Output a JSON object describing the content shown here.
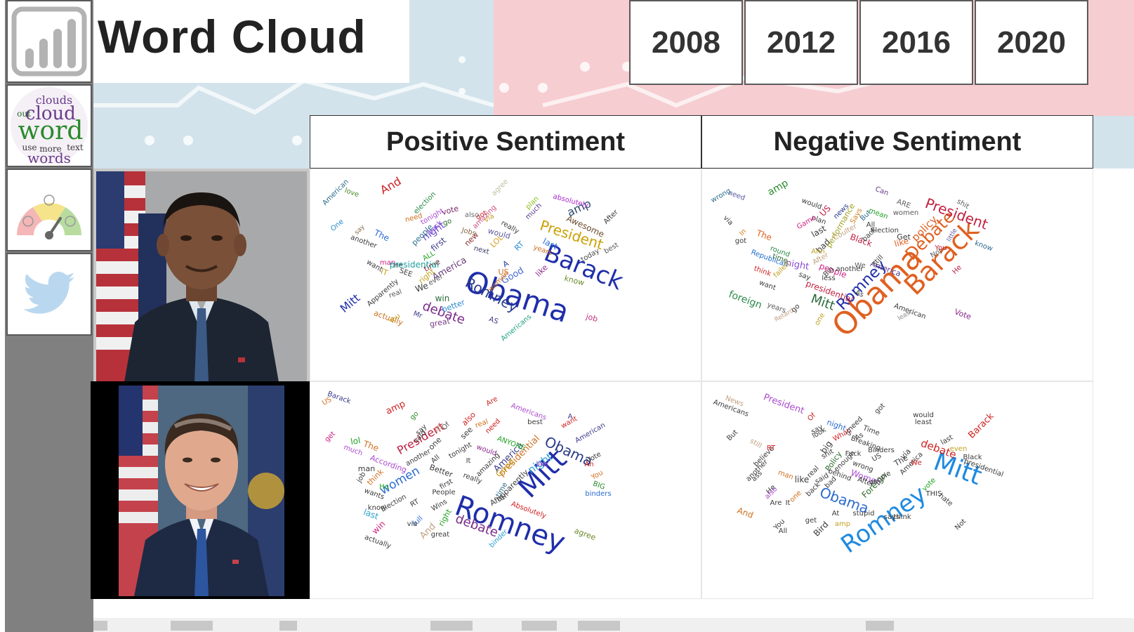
{
  "header": {
    "title": "Word Cloud"
  },
  "nav": {
    "report_icon": "report-bar-chart-icon",
    "cloud_icon": "word-cloud-icon",
    "gauge_icon": "sentiment-gauge-icon",
    "twitter_icon": "twitter-bird-icon",
    "cloud_thumb_words": [
      "clouds",
      "cloud",
      "word",
      "out",
      "use",
      "more",
      "text",
      "words"
    ]
  },
  "years": [
    "2008",
    "2012",
    "2016",
    "2020"
  ],
  "columns": {
    "positive": "Positive Sentiment",
    "negative": "Negative Sentiment"
  },
  "colors": {
    "nav_bg": "#808080",
    "blue_band": "#d3e3ec",
    "pink_band": "#f6cdd1"
  },
  "clouds": {
    "obama_positive": [
      {
        "w": "Obama",
        "c": "#1f2eaa"
      },
      {
        "w": "Barack",
        "c": "#1f2eaa"
      },
      {
        "w": "Romney",
        "c": "#2a3a8a"
      },
      {
        "w": "President",
        "c": "#c9a000"
      },
      {
        "w": "debate",
        "c": "#7a2a8a"
      },
      {
        "w": "Mitt",
        "c": "#1f2eaa"
      },
      {
        "w": "And",
        "c": "#d02020"
      },
      {
        "w": "amp",
        "c": "#2a4a6a"
      },
      {
        "w": "Good",
        "c": "#4a6ad0"
      },
      {
        "w": "America",
        "c": "#6a3a7a"
      },
      {
        "w": "night",
        "c": "#6a4ad0"
      },
      {
        "w": "first",
        "c": "#3a3a8a"
      },
      {
        "w": "win",
        "c": "#2a6a3a"
      },
      {
        "w": "better",
        "c": "#2a8ad0"
      },
      {
        "w": "great",
        "c": "#7a3a8a"
      },
      {
        "w": "job",
        "c": "#c03080"
      },
      {
        "w": "know",
        "c": "#6a8a2a"
      },
      {
        "w": "like",
        "c": "#8a2a8a"
      },
      {
        "w": "last",
        "c": "#1f6ad0"
      },
      {
        "w": "Awesome",
        "c": "#6a4a2a"
      },
      {
        "w": "vote",
        "c": "#7a2a6a"
      },
      {
        "w": "American",
        "c": "#2a6a8a"
      },
      {
        "w": "love",
        "c": "#4a8a2a"
      },
      {
        "w": "One",
        "c": "#2a8ad0"
      },
      {
        "w": "The",
        "c": "#2a6ad0"
      },
      {
        "w": "another",
        "c": "#3a3a3a"
      },
      {
        "w": "say",
        "c": "#8a6a4a"
      },
      {
        "w": "need",
        "c": "#d07020"
      },
      {
        "w": "people",
        "c": "#2a6a8a"
      },
      {
        "w": "back",
        "c": "#8a4ad0"
      },
      {
        "w": "election",
        "c": "#2a8a4a"
      },
      {
        "w": "tonight",
        "c": "#aa4ad0"
      },
      {
        "w": "agree",
        "c": "#c0c0a0"
      },
      {
        "w": "got",
        "c": "#d02020"
      },
      {
        "w": "amazing",
        "c": "#d05080"
      },
      {
        "w": "via",
        "c": "#c0a020"
      },
      {
        "w": "Jobs",
        "c": "#8a6a4a"
      },
      {
        "w": "new",
        "c": "#8a2a2a"
      },
      {
        "w": "next",
        "c": "#3a3a6a"
      },
      {
        "w": "would",
        "c": "#5a5aa0"
      },
      {
        "w": "LOL",
        "c": "#d0a020"
      },
      {
        "w": "really",
        "c": "#3a3a3a"
      },
      {
        "w": "RT",
        "c": "#2a8ad0"
      },
      {
        "w": "years",
        "c": "#d07020"
      },
      {
        "w": "today",
        "c": "#4a4a4a"
      },
      {
        "w": "best",
        "c": "#5a5a5a"
      },
      {
        "w": "After",
        "c": "#3a3a3a"
      },
      {
        "w": "absolutely",
        "c": "#aa2ad0"
      },
      {
        "w": "much",
        "c": "#5a3a8a"
      },
      {
        "w": "plan",
        "c": "#8ac020"
      },
      {
        "w": "go",
        "c": "#2a6a2a"
      },
      {
        "w": "IT",
        "c": "#c0a020"
      },
      {
        "w": "Apparently",
        "c": "#3a3a3a"
      },
      {
        "w": "real",
        "c": "#5a5a5a"
      },
      {
        "w": "We",
        "c": "#3a3a3a"
      },
      {
        "w": "right",
        "c": "#c0a020"
      },
      {
        "w": "ever",
        "c": "#5a5a5a"
      },
      {
        "w": "time",
        "c": "#8a2a2a"
      },
      {
        "w": "ALL",
        "c": "#20a020"
      },
      {
        "w": "want",
        "c": "#3a3a3a"
      },
      {
        "w": "man",
        "c": "#d02080"
      },
      {
        "w": "He",
        "c": "#3a3a3a"
      },
      {
        "w": "SEE",
        "c": "#3a3a3a"
      },
      {
        "w": "presidential",
        "c": "#20a0a0"
      },
      {
        "w": "A",
        "c": "#2a3a8a"
      },
      {
        "w": "US",
        "c": "#d07020"
      },
      {
        "w": "women",
        "c": "#d07020"
      },
      {
        "w": "AS",
        "c": "#3a3a8a"
      },
      {
        "w": "Americans",
        "c": "#20a080"
      },
      {
        "w": "actually",
        "c": "#d07020"
      },
      {
        "w": "You",
        "c": "#c0a020"
      },
      {
        "w": "Mr",
        "c": "#3a3a8a"
      },
      {
        "w": "also",
        "c": "#6a6a6a"
      },
      {
        "w": "Are",
        "c": "#3a3a3a"
      }
    ],
    "obama_negative": [
      {
        "w": "Obama",
        "c": "#e06020"
      },
      {
        "w": "Barack",
        "c": "#e06020"
      },
      {
        "w": "Debate",
        "c": "#e06020"
      },
      {
        "w": "Romney",
        "c": "#1f2eaa"
      },
      {
        "w": "President",
        "c": "#c02040"
      },
      {
        "w": "Mitt",
        "c": "#2a6a3a"
      },
      {
        "w": "policy",
        "c": "#e06020"
      },
      {
        "w": "foreign",
        "c": "#2a8a4a"
      },
      {
        "w": "amp",
        "c": "#2a8a2a"
      },
      {
        "w": "people",
        "c": "#d02080"
      },
      {
        "w": "night",
        "c": "#8a4ad0"
      },
      {
        "w": "presidential",
        "c": "#c02040"
      },
      {
        "w": "America",
        "c": "#5a3a8a"
      },
      {
        "w": "like",
        "c": "#e06020"
      },
      {
        "w": "bad",
        "c": "#3a3a3a"
      },
      {
        "w": "last",
        "c": "#3a3a3a"
      },
      {
        "w": "Black",
        "c": "#c02040"
      },
      {
        "w": "The",
        "c": "#e06020"
      },
      {
        "w": "wrong",
        "c": "#2a6a8a"
      },
      {
        "w": "need",
        "c": "#5a5aa0"
      },
      {
        "w": "would",
        "c": "#3a3a3a"
      },
      {
        "w": "US",
        "c": "#c02040"
      },
      {
        "w": "plan",
        "c": "#3a3a3a"
      },
      {
        "w": "news",
        "c": "#2a3a8a"
      },
      {
        "w": "Says",
        "c": "#d08020"
      },
      {
        "w": "But",
        "c": "#2a6a8a"
      },
      {
        "w": "mean",
        "c": "#20a020"
      },
      {
        "w": "Can",
        "c": "#6a3a8a"
      },
      {
        "w": "ARE",
        "c": "#5a5a5a"
      },
      {
        "w": "women",
        "c": "#5a5a5a"
      },
      {
        "w": "shit",
        "c": "#5a5a5a"
      },
      {
        "w": "know",
        "c": "#2a6a8a"
      },
      {
        "w": "little",
        "c": "#5a5aa0"
      },
      {
        "w": "He",
        "c": "#c02040"
      },
      {
        "w": "Vote",
        "c": "#8a2a8a"
      },
      {
        "w": "American",
        "c": "#3a3a3a"
      },
      {
        "w": "least",
        "c": "#8a8a8a"
      },
      {
        "w": "Retard",
        "c": "#c0a080"
      },
      {
        "w": "go",
        "c": "#3a3a3a"
      },
      {
        "w": "years",
        "c": "#5a5a5a"
      },
      {
        "w": "one",
        "c": "#c0a020"
      },
      {
        "w": "Republican",
        "c": "#1f6ad0"
      },
      {
        "w": "round",
        "c": "#2a8a4a"
      },
      {
        "w": "time",
        "c": "#2a6a2a"
      },
      {
        "w": "failed",
        "c": "#c0a020"
      },
      {
        "w": "think",
        "c": "#d02020"
      },
      {
        "w": "want",
        "c": "#3a3a3a"
      },
      {
        "w": "say",
        "c": "#3a3a3a"
      },
      {
        "w": "less",
        "c": "#3a3a3a"
      },
      {
        "w": "Big",
        "c": "#3a3a3a"
      },
      {
        "w": "another",
        "c": "#3a3a3a"
      },
      {
        "w": "Game",
        "c": "#d02080"
      },
      {
        "w": "performance",
        "c": "#a0a020"
      },
      {
        "w": "Coulter",
        "c": "#c0a080"
      },
      {
        "w": "All",
        "c": "#3a3a3a"
      },
      {
        "w": "back",
        "c": "#3a3a3a"
      },
      {
        "w": "Election",
        "c": "#3a3a3a"
      },
      {
        "w": "Get",
        "c": "#3a3a3a"
      },
      {
        "w": "You",
        "c": "#c02040"
      },
      {
        "w": "Not",
        "c": "#5a5a5a"
      },
      {
        "w": "We",
        "c": "#5a5a5a"
      },
      {
        "w": "still",
        "c": "#3a3a3a"
      },
      {
        "w": "After",
        "c": "#c0a080"
      },
      {
        "w": "Ann",
        "c": "#c0a020"
      },
      {
        "w": "As",
        "c": "#3a3a3a"
      },
      {
        "w": "via",
        "c": "#3a3a3a"
      },
      {
        "w": "In",
        "c": "#d08020"
      },
      {
        "w": "got",
        "c": "#3a3a3a"
      },
      {
        "w": "RT",
        "c": "#3a3a3a"
      }
    ],
    "romney_positive": [
      {
        "w": "Romney",
        "c": "#1f2eaa"
      },
      {
        "w": "Mitt",
        "c": "#1f2eaa"
      },
      {
        "w": "debate",
        "c": "#7a2a8a"
      },
      {
        "w": "Obama",
        "c": "#2a3a8a"
      },
      {
        "w": "President",
        "c": "#c02040"
      },
      {
        "w": "presidential",
        "c": "#d07020"
      },
      {
        "w": "women",
        "c": "#2a6ad0"
      },
      {
        "w": "night",
        "c": "#2aa0d0"
      },
      {
        "w": "America",
        "c": "#3a3a8a"
      },
      {
        "w": "Good",
        "c": "#c0a020"
      },
      {
        "w": "amp",
        "c": "#d02020"
      },
      {
        "w": "Barack",
        "c": "#3a3a8a"
      },
      {
        "w": "US",
        "c": "#d07020"
      },
      {
        "w": "go",
        "c": "#2a8a2a"
      },
      {
        "w": "Are",
        "c": "#d02020"
      },
      {
        "w": "Americans",
        "c": "#aa4ad0"
      },
      {
        "w": "best",
        "c": "#3a3a3a"
      },
      {
        "w": "want",
        "c": "#d02020"
      },
      {
        "w": "A",
        "c": "#3a3a8a"
      },
      {
        "w": "American",
        "c": "#3a3a8a"
      },
      {
        "w": "Vote",
        "c": "#3a3a3a"
      },
      {
        "w": "An",
        "c": "#d02020"
      },
      {
        "w": "You",
        "c": "#d07020"
      },
      {
        "w": "BIG",
        "c": "#2a8a2a"
      },
      {
        "w": "binders",
        "c": "#2a6ad0"
      },
      {
        "w": "like",
        "c": "#aa4ad0"
      },
      {
        "w": "ANYONE",
        "c": "#20a020"
      },
      {
        "w": "would",
        "c": "#8a2a8a"
      },
      {
        "w": "need",
        "c": "#d02020"
      },
      {
        "w": "real",
        "c": "#d07020"
      },
      {
        "w": "also",
        "c": "#d02020"
      },
      {
        "w": "see",
        "c": "#3a3a3a"
      },
      {
        "w": "Of",
        "c": "#5a5a5a"
      },
      {
        "w": "AS",
        "c": "#c0a080"
      },
      {
        "w": "say",
        "c": "#3a3a3a"
      },
      {
        "w": "said",
        "c": "#3a3a3a"
      },
      {
        "w": "one",
        "c": "#3a3a3a"
      },
      {
        "w": "All",
        "c": "#3a3a3a"
      },
      {
        "w": "another",
        "c": "#3a3a3a"
      },
      {
        "w": "The",
        "c": "#d07020"
      },
      {
        "w": "lol",
        "c": "#20a020"
      },
      {
        "w": "much",
        "c": "#aa4ad0"
      },
      {
        "w": "get",
        "c": "#d02080"
      },
      {
        "w": "According",
        "c": "#aa4ad0"
      },
      {
        "w": "think",
        "c": "#d07020"
      },
      {
        "w": "man",
        "c": "#3a3a3a"
      },
      {
        "w": "job",
        "c": "#3a3a3a"
      },
      {
        "w": "He",
        "c": "#20a020"
      },
      {
        "w": "wants",
        "c": "#3a3a3a"
      },
      {
        "w": "know",
        "c": "#3a3a3a"
      },
      {
        "w": "last",
        "c": "#2aa0d0"
      },
      {
        "w": "Election",
        "c": "#3a3a3a"
      },
      {
        "w": "RT",
        "c": "#3a3a3a"
      },
      {
        "w": "win",
        "c": "#d02080"
      },
      {
        "w": "full",
        "c": "#2a6ad0"
      },
      {
        "w": "via",
        "c": "#3a3a3a"
      },
      {
        "w": "And",
        "c": "#c0a080"
      },
      {
        "w": "right",
        "c": "#20a020"
      },
      {
        "w": "great",
        "c": "#3a3a3a"
      },
      {
        "w": "actually",
        "c": "#3a3a3a"
      },
      {
        "w": "binder",
        "c": "#2aa0d0"
      },
      {
        "w": "agree",
        "c": "#6a8a2a"
      },
      {
        "w": "After",
        "c": "#3a3a3a"
      },
      {
        "w": "apparently",
        "c": "#3a3a3a"
      },
      {
        "w": "time",
        "c": "#2a6a8a"
      },
      {
        "w": "really",
        "c": "#3a3a3a"
      },
      {
        "w": "People",
        "c": "#3a3a3a"
      },
      {
        "w": "Wins",
        "c": "#3a3a3a"
      },
      {
        "w": "first",
        "c": "#3a3a3a"
      },
      {
        "w": "Better",
        "c": "#3a3a3a"
      },
      {
        "w": "tonight",
        "c": "#3a3a3a"
      },
      {
        "w": "It",
        "c": "#3a3a3a"
      },
      {
        "w": "amazing",
        "c": "#3a3a3a"
      },
      {
        "w": "Absolutely",
        "c": "#d02020"
      }
    ],
    "romney_negative": [
      {
        "w": "Romney",
        "c": "#1f8ae0"
      },
      {
        "w": "Mitt",
        "c": "#1f8ae0"
      },
      {
        "w": "Obama",
        "c": "#2a6ad0"
      },
      {
        "w": "debate",
        "c": "#d02020"
      },
      {
        "w": "President",
        "c": "#aa4ad0"
      },
      {
        "w": "Barack",
        "c": "#d02020"
      },
      {
        "w": "Policy",
        "c": "#2a6a2a"
      },
      {
        "w": "Women",
        "c": "#aa4ad0"
      },
      {
        "w": "Foreign",
        "c": "#2a6a2a"
      },
      {
        "w": "night",
        "c": "#2a6ad0"
      },
      {
        "w": "big",
        "c": "#3a3a3a"
      },
      {
        "w": "like",
        "c": "#3a3a3a"
      },
      {
        "w": "man",
        "c": "#d07020"
      },
      {
        "w": "He",
        "c": "#3a3a3a"
      },
      {
        "w": "also",
        "c": "#aa4ad0"
      },
      {
        "w": "Are",
        "c": "#3a3a3a"
      },
      {
        "w": "It",
        "c": "#3a3a3a"
      },
      {
        "w": "And",
        "c": "#d07020"
      },
      {
        "w": "another",
        "c": "#3a3a3a"
      },
      {
        "w": "ass",
        "c": "#3a3a3a"
      },
      {
        "w": "believe",
        "c": "#3a3a3a"
      },
      {
        "w": "RT",
        "c": "#d02020"
      },
      {
        "w": "still",
        "c": "#c0a080"
      },
      {
        "w": "But",
        "c": "#3a3a3a"
      },
      {
        "w": "News",
        "c": "#c0a080"
      },
      {
        "w": "Americans",
        "c": "#3a3a3a"
      },
      {
        "w": "Of",
        "c": "#d02020"
      },
      {
        "w": "look",
        "c": "#3a3a3a"
      },
      {
        "w": "say",
        "c": "#3a3a3a"
      },
      {
        "w": "What",
        "c": "#d02020"
      },
      {
        "w": "shit",
        "c": "#3a3a3a"
      },
      {
        "w": "real",
        "c": "#3a3a3a"
      },
      {
        "w": "said",
        "c": "#3a3a3a"
      },
      {
        "w": "back",
        "c": "#3a3a3a"
      },
      {
        "w": "bad",
        "c": "#3a3a3a"
      },
      {
        "w": "behind",
        "c": "#3a3a3a"
      },
      {
        "w": "enough",
        "c": "#3a3a3a"
      },
      {
        "w": "Fuck",
        "c": "#3a3a3a"
      },
      {
        "w": "wrong",
        "c": "#3a3a3a"
      },
      {
        "w": "Breaking",
        "c": "#3a3a3a"
      },
      {
        "w": "Binders",
        "c": "#3a3a3a"
      },
      {
        "w": "need",
        "c": "#3a3a3a"
      },
      {
        "w": "As",
        "c": "#3a3a3a"
      },
      {
        "w": "Is",
        "c": "#3a3a3a"
      },
      {
        "w": "Time",
        "c": "#3a3a3a"
      },
      {
        "w": "US",
        "c": "#3a3a3a"
      },
      {
        "w": "The",
        "c": "#3a3a3a"
      },
      {
        "w": "via",
        "c": "#3a3a3a"
      },
      {
        "w": "America",
        "c": "#3a3a3a"
      },
      {
        "w": "People",
        "c": "#3a3a3a"
      },
      {
        "w": "After",
        "c": "#3a3a3a"
      },
      {
        "w": "We",
        "c": "#d02020"
      },
      {
        "w": "vote",
        "c": "#20a020"
      },
      {
        "w": "THIS",
        "c": "#3a3a3a"
      },
      {
        "w": "hate",
        "c": "#3a3a3a"
      },
      {
        "w": "last",
        "c": "#3a3a3a"
      },
      {
        "w": "even",
        "c": "#c0a020"
      },
      {
        "w": "Black",
        "c": "#3a3a3a"
      },
      {
        "w": "presidential",
        "c": "#3a3a3a"
      },
      {
        "w": "would",
        "c": "#3a3a3a"
      },
      {
        "w": "least",
        "c": "#3a3a3a"
      },
      {
        "w": "got",
        "c": "#3a3a3a"
      },
      {
        "w": "one",
        "c": "#d07020"
      },
      {
        "w": "At",
        "c": "#3a3a3a"
      },
      {
        "w": "get",
        "c": "#3a3a3a"
      },
      {
        "w": "Bird",
        "c": "#3a3a3a"
      },
      {
        "w": "stupid",
        "c": "#3a3a3a"
      },
      {
        "w": "amp",
        "c": "#c0a020"
      },
      {
        "w": "You",
        "c": "#3a3a3a"
      },
      {
        "w": "All",
        "c": "#3a3a3a"
      },
      {
        "w": "says",
        "c": "#3a3a3a"
      },
      {
        "w": "think",
        "c": "#3a3a3a"
      },
      {
        "w": "Not",
        "c": "#3a3a3a"
      },
      {
        "w": "know",
        "c": "#3a3a3a"
      }
    ]
  }
}
